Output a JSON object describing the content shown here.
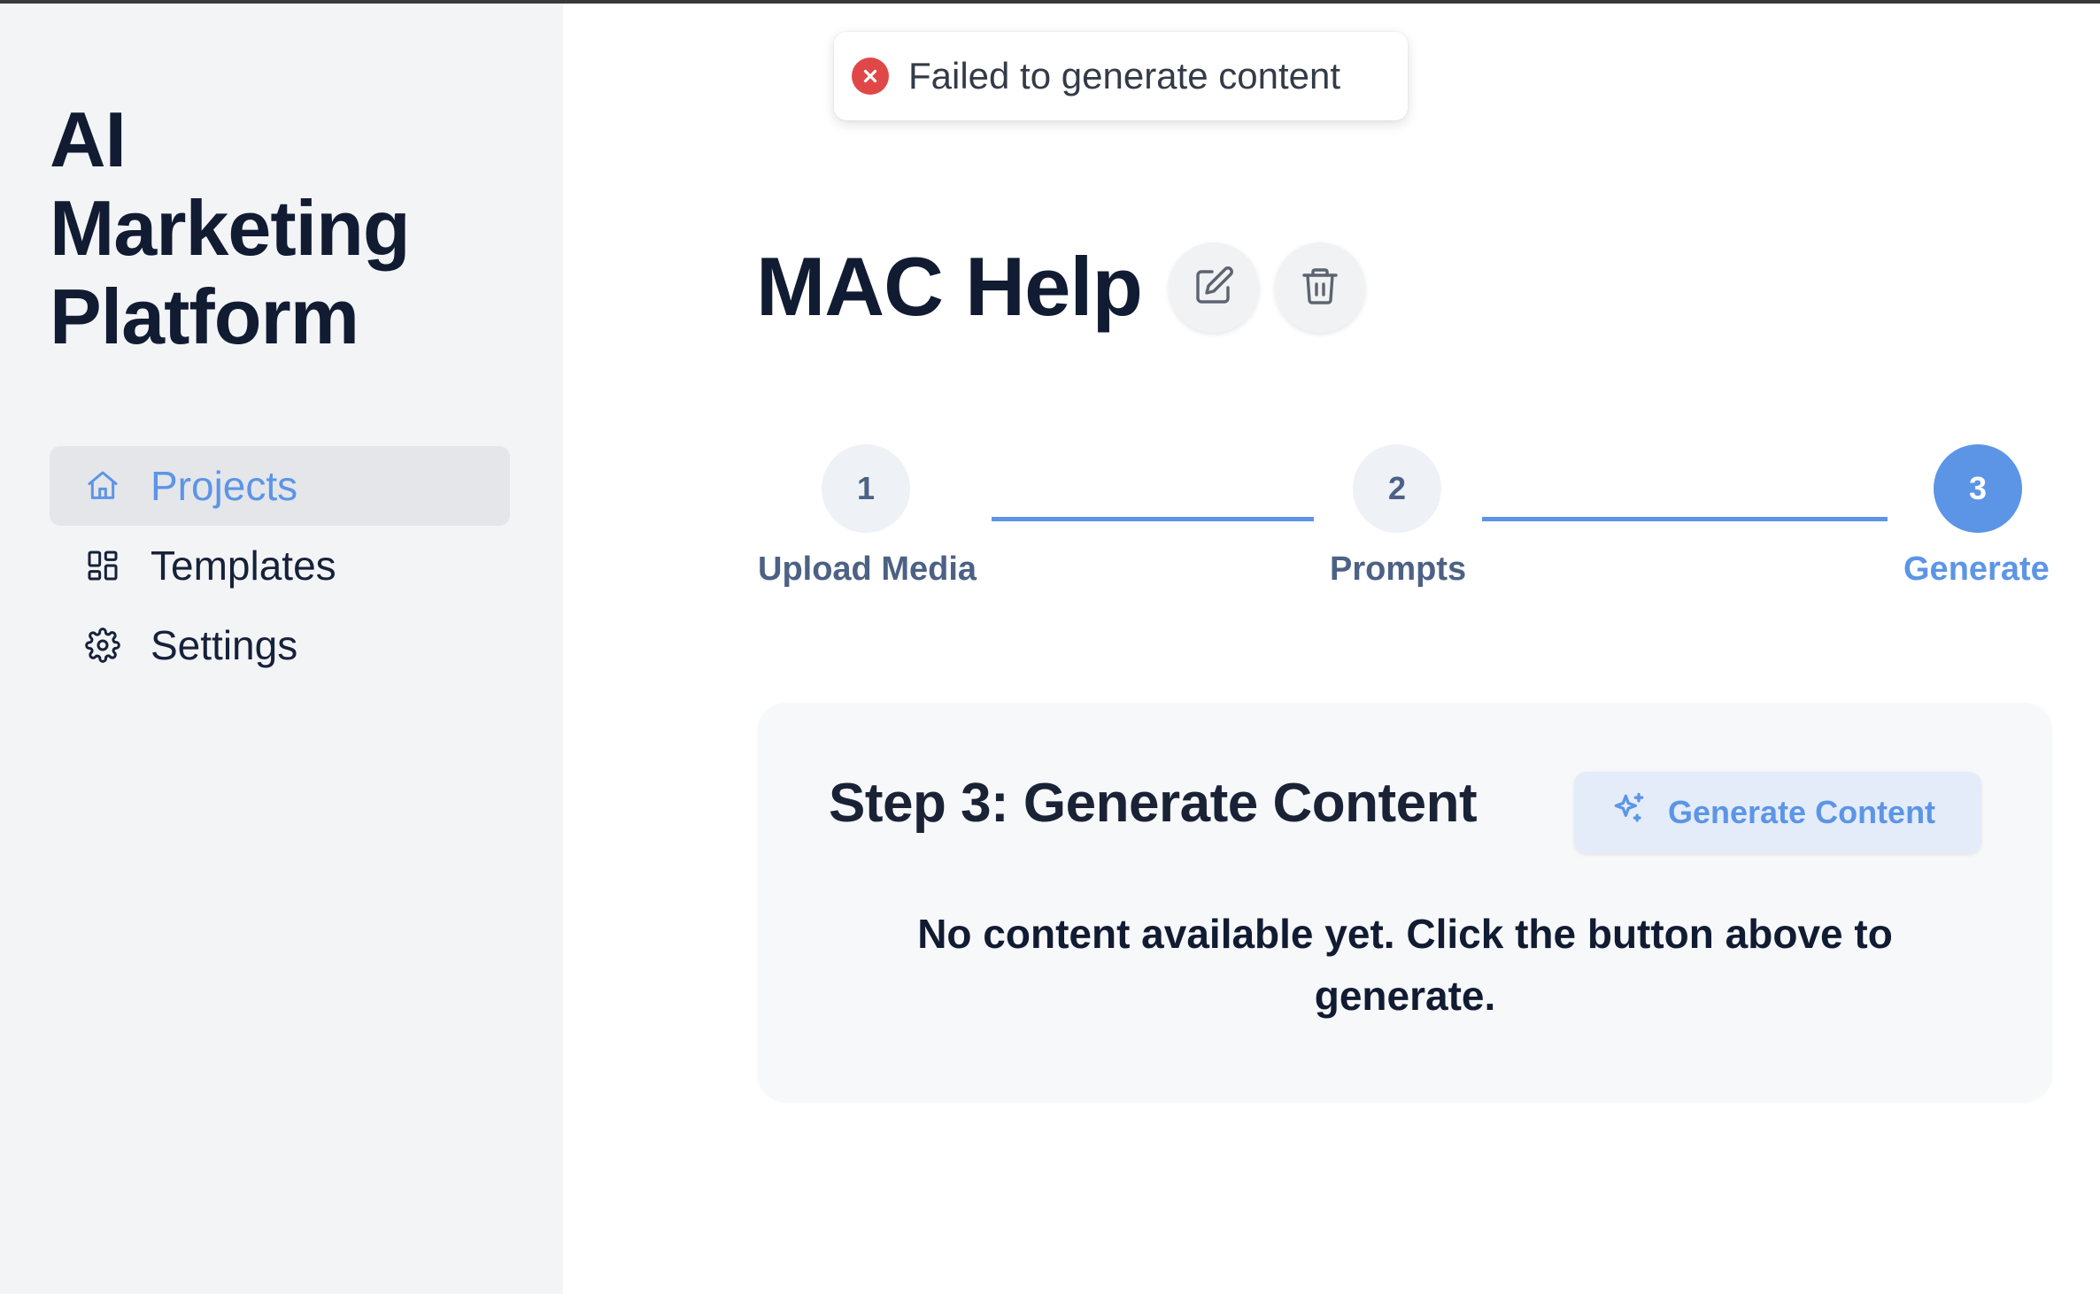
{
  "sidebar": {
    "brand_lines": [
      "AI",
      "Marketing",
      "Platform"
    ],
    "nav": [
      {
        "label": "Projects",
        "icon": "home-icon",
        "active": true
      },
      {
        "label": "Templates",
        "icon": "grid-icon",
        "active": false
      },
      {
        "label": "Settings",
        "icon": "gear-icon",
        "active": false
      }
    ]
  },
  "toast": {
    "message": "Failed to generate content",
    "icon": "error-circle-icon",
    "color": "#e04848"
  },
  "header": {
    "title": "MAC Help",
    "actions": [
      {
        "icon": "edit-icon"
      },
      {
        "icon": "trash-icon"
      }
    ]
  },
  "stepper": {
    "steps": [
      {
        "number": "1",
        "label": "Upload Media",
        "active": false
      },
      {
        "number": "2",
        "label": "Prompts",
        "active": false
      },
      {
        "number": "3",
        "label": "Generate",
        "active": true
      }
    ]
  },
  "card": {
    "title": "Step 3: Generate Content",
    "button_label": "Generate Content",
    "button_icon": "sparkles-icon",
    "empty_message": "No content available yet. Click the button above to generate."
  },
  "colors": {
    "accent": "#5c95e6",
    "sidebar_bg": "#f3f4f6",
    "text_dark": "#111c33"
  }
}
